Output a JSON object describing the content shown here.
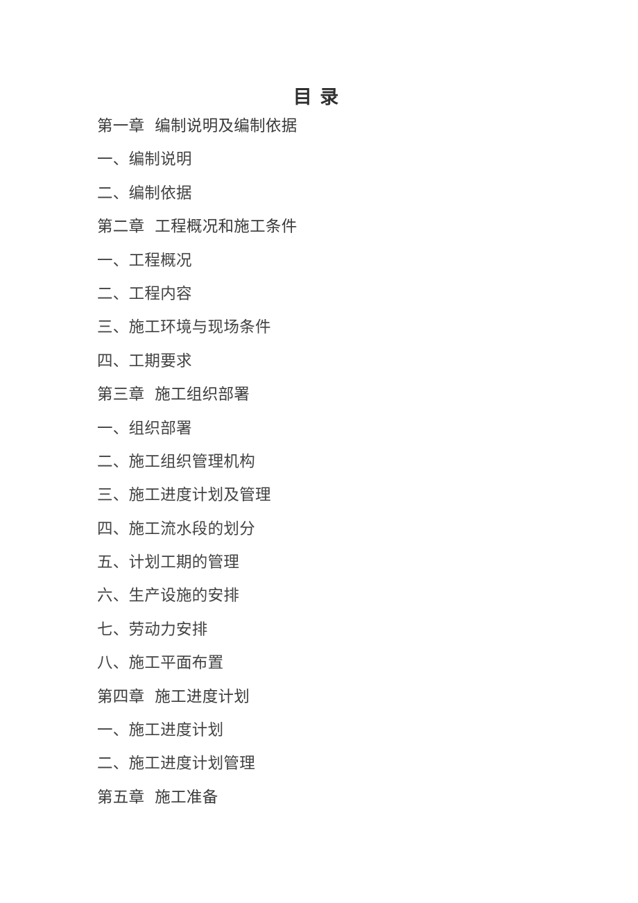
{
  "document": {
    "title": "目 录",
    "background_color": "#ffffff",
    "text_color": "#3d3d3d"
  },
  "toc": {
    "entries": [
      {
        "text": "第一章  编制说明及编制依据",
        "level": "chapter"
      },
      {
        "text": "一、编制说明",
        "level": "section"
      },
      {
        "text": "二、编制依据",
        "level": "section"
      },
      {
        "text": "第二章  工程概况和施工条件",
        "level": "chapter"
      },
      {
        "text": "一、工程概况",
        "level": "section"
      },
      {
        "text": "二、工程内容",
        "level": "section"
      },
      {
        "text": "三、施工环境与现场条件",
        "level": "section"
      },
      {
        "text": "四、工期要求",
        "level": "section"
      },
      {
        "text": "第三章  施工组织部署",
        "level": "chapter"
      },
      {
        "text": "一、组织部署",
        "level": "section"
      },
      {
        "text": "二、施工组织管理机构",
        "level": "section"
      },
      {
        "text": "三、施工进度计划及管理",
        "level": "section"
      },
      {
        "text": "四、施工流水段的划分",
        "level": "section"
      },
      {
        "text": "五、计划工期的管理",
        "level": "section"
      },
      {
        "text": "六、生产设施的安排",
        "level": "section"
      },
      {
        "text": "七、劳动力安排",
        "level": "section"
      },
      {
        "text": "八、施工平面布置",
        "level": "section"
      },
      {
        "text": "第四章  施工进度计划",
        "level": "chapter"
      },
      {
        "text": "一、施工进度计划",
        "level": "section"
      },
      {
        "text": "二、施工进度计划管理",
        "level": "section"
      },
      {
        "text": "第五章  施工准备",
        "level": "chapter"
      }
    ]
  }
}
